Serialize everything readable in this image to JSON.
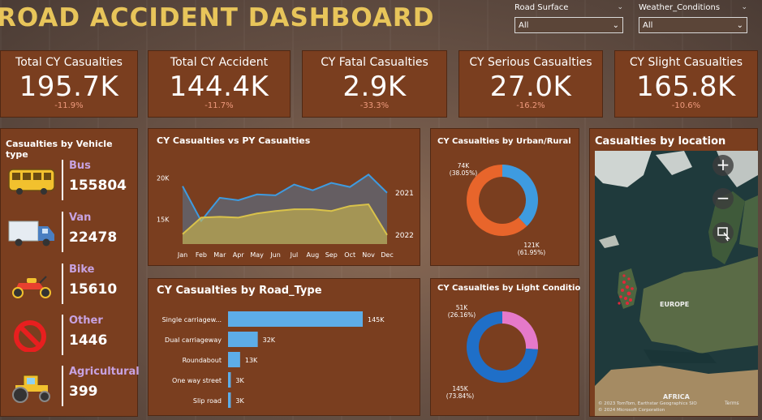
{
  "title": "ROAD ACCIDENT DASHBOARD",
  "filters": [
    {
      "label": "Road Surface",
      "value": "All"
    },
    {
      "label": "Weather_Conditions",
      "value": "All"
    }
  ],
  "kpis": [
    {
      "title": "Total CY Casualties",
      "value": "195.7K",
      "change": "-11.9%"
    },
    {
      "title": "Total CY Accident",
      "value": "144.4K",
      "change": "-11.7%"
    },
    {
      "title": "CY Fatal Casualties",
      "value": "2.9K",
      "change": "-33.3%"
    },
    {
      "title": "CY Serious Casualties",
      "value": "27.0K",
      "change": "-16.2%"
    },
    {
      "title": "CY Slight Casualties",
      "value": "165.8K",
      "change": "-10.6%"
    }
  ],
  "vehicle_panel": {
    "title": "Casualties by Vehicle type",
    "items": [
      {
        "name": "Bus",
        "value": "155804",
        "icon": "bus-icon"
      },
      {
        "name": "Van",
        "value": "22478",
        "icon": "truck-icon"
      },
      {
        "name": "Bike",
        "value": "15610",
        "icon": "motorbike-icon"
      },
      {
        "name": "Other",
        "value": "1446",
        "icon": "prohibited-icon"
      },
      {
        "name": "Agricultural",
        "value": "399",
        "icon": "tractor-icon"
      }
    ]
  },
  "colors": {
    "panel": "#7a3e1f",
    "title": "#e8c55a",
    "blue": "#3e9be0",
    "yellow": "#d9c24a",
    "orange": "#e8652b",
    "pink": "#e579c9",
    "darkblue": "#1f6fc8",
    "bar": "#5dade8"
  },
  "chart_data": [
    {
      "type": "area",
      "title": "CY Casualties vs PY Casualties",
      "x": [
        "Jan",
        "Feb",
        "Mar",
        "Apr",
        "May",
        "Jun",
        "Jul",
        "Aug",
        "Sep",
        "Oct",
        "Nov",
        "Dec"
      ],
      "ticks_y": [
        "15K",
        "20K"
      ],
      "ylim": [
        12000,
        22000
      ],
      "series": [
        {
          "name": "2021",
          "values": [
            19000,
            14800,
            17600,
            17300,
            18000,
            17900,
            19200,
            18500,
            19400,
            18900,
            20400,
            18200
          ]
        },
        {
          "name": "2022",
          "values": [
            13200,
            15200,
            15300,
            15200,
            15700,
            16000,
            16200,
            16200,
            16000,
            16600,
            16800,
            13100
          ]
        }
      ]
    },
    {
      "type": "bar",
      "title": "CY Casualties by Road_Type",
      "categories": [
        "Single carriagew...",
        "Dual carriageway",
        "Roundabout",
        "One way street",
        "Slip road"
      ],
      "values": [
        145,
        32,
        13,
        3,
        3
      ],
      "labels": [
        "145K",
        "32K",
        "13K",
        "3K",
        "3K"
      ]
    },
    {
      "type": "pie",
      "title": "CY Casualties by Urban/Rural",
      "values": [
        74,
        121
      ],
      "labels": [
        "74K",
        "121K"
      ],
      "percents": [
        "(38.05%)",
        "(61.95%)"
      ]
    },
    {
      "type": "pie",
      "title": "CY Casualties by Light Condition",
      "values": [
        51,
        145
      ],
      "labels": [
        "51K",
        "145K"
      ],
      "percents": [
        "(26.16%)",
        "(73.84%)"
      ]
    }
  ],
  "map": {
    "title": "Casualties by location",
    "labels": {
      "europe": "EUROPE",
      "africa": "AFRICA"
    },
    "credit_1": "© 2023 TomTom, Earthstar Geographics SIO",
    "credit_2": "© 2024 Microsoft Corporation",
    "terms": "Terms",
    "zoom_in": "+",
    "zoom_out": "−"
  }
}
